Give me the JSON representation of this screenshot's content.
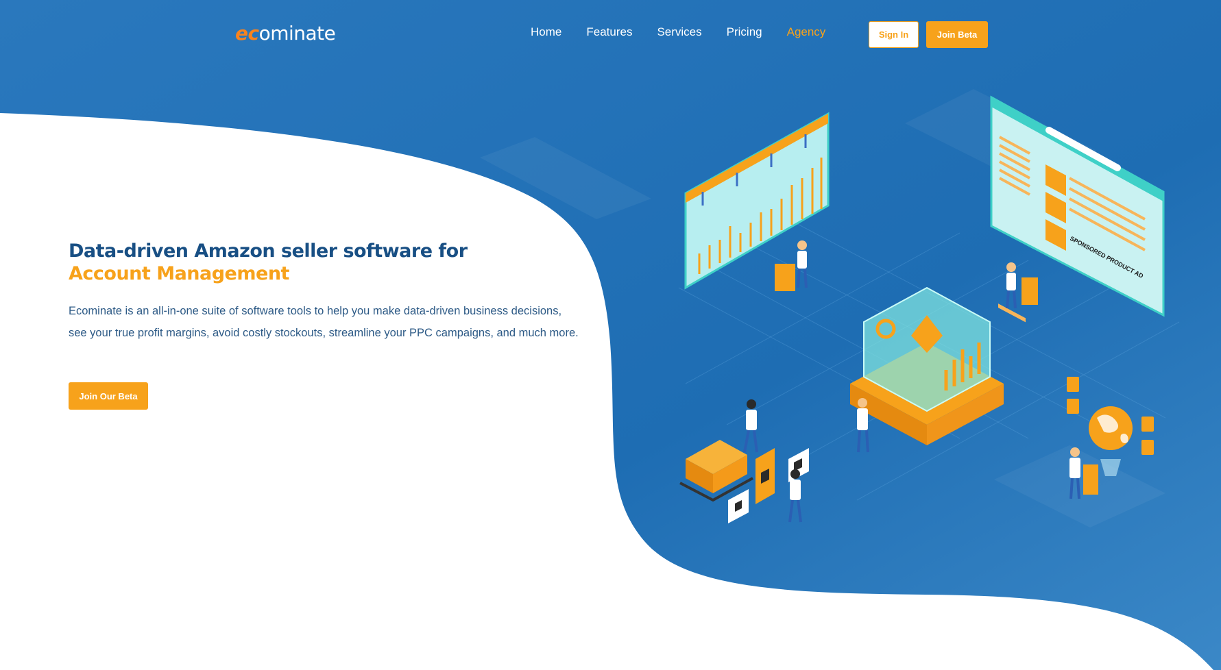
{
  "colors": {
    "brand_blue": "#1f6fb5",
    "brand_orange": "#f7a21b",
    "heading_blue": "#184f84",
    "white": "#ffffff"
  },
  "nav": {
    "logo_prefix": "ec",
    "logo_suffix": "ominate",
    "items": [
      {
        "label": "Home",
        "active": false
      },
      {
        "label": "Features",
        "active": false
      },
      {
        "label": "Services",
        "active": false
      },
      {
        "label": "Pricing",
        "active": false
      },
      {
        "label": "Agency",
        "active": true
      }
    ],
    "sign_in_label": "Sign In",
    "join_beta_label": "Join Beta"
  },
  "hero": {
    "title_line1": "Data-driven Amazon seller software for",
    "title_line2": "Account Management",
    "description": "Ecominate is an all-in-one suite of software tools to help you make data-driven business decisions, see your true profit margins, avoid costly stockouts, streamline your PPC campaigns, and much more.",
    "cta_label": "Join Our Beta"
  },
  "illustration": {
    "ad_label": "SPONSORED PRODUCT AD",
    "icons": [
      "bar-chart-screen-icon",
      "browser-ad-screen-icon",
      "data-cube-icon",
      "warehouse-boxes-icon",
      "globe-icon",
      "people-figures-icon"
    ]
  }
}
